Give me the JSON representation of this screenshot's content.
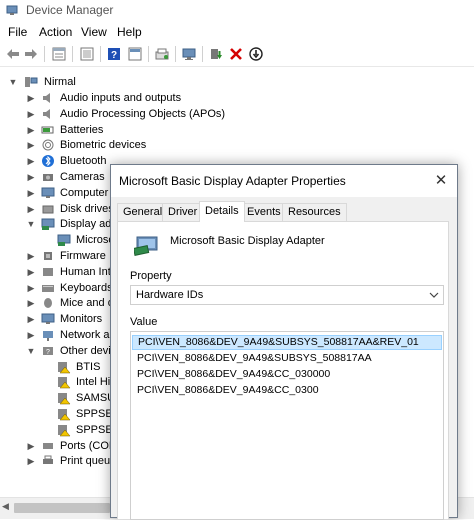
{
  "window": {
    "title": "Device Manager"
  },
  "menu": [
    "File",
    "Action",
    "View",
    "Help"
  ],
  "toolbar": {
    "buttons": [
      "back-icon",
      "forward-icon",
      "properties-icon",
      "show-hide-icon",
      "help-icon",
      "console-icon",
      "scan-hardware-icon",
      "monitor-icon",
      "update-driver-icon",
      "uninstall-icon",
      "disable-icon"
    ]
  },
  "tree": {
    "root": "Nirmal",
    "items": [
      {
        "label": "Audio inputs and outputs",
        "icon": "speaker-icon"
      },
      {
        "label": "Audio Processing Objects (APOs)",
        "icon": "speaker-icon"
      },
      {
        "label": "Batteries",
        "icon": "battery-icon"
      },
      {
        "label": "Biometric devices",
        "icon": "fingerprint-icon"
      },
      {
        "label": "Bluetooth",
        "icon": "bluetooth-icon"
      },
      {
        "label": "Cameras",
        "icon": "camera-icon"
      },
      {
        "label": "Computer",
        "icon": "computer-icon"
      },
      {
        "label": "Disk drives",
        "icon": "disk-icon"
      },
      {
        "label": "Display ada",
        "icon": "display-icon"
      },
      {
        "label": "Microso",
        "icon": "display-icon"
      },
      {
        "label": "Firmware",
        "icon": "firmware-icon"
      },
      {
        "label": "Human Inte",
        "icon": "hid-icon"
      },
      {
        "label": "Keyboards",
        "icon": "keyboard-icon"
      },
      {
        "label": "Mice and ot",
        "icon": "mouse-icon"
      },
      {
        "label": "Monitors",
        "icon": "monitor-icon"
      },
      {
        "label": "Network ad",
        "icon": "network-icon"
      },
      {
        "label": "Other devic",
        "icon": "unknown-device-icon"
      },
      {
        "label": "BTIS",
        "icon": "warning-device-icon"
      },
      {
        "label": "Intel Hi",
        "icon": "warning-device-icon"
      },
      {
        "label": "SAMSU",
        "icon": "warning-device-icon"
      },
      {
        "label": "SPPSER",
        "icon": "warning-device-icon"
      },
      {
        "label": "SPPSER",
        "icon": "warning-device-icon"
      },
      {
        "label": "Ports (COM",
        "icon": "port-icon"
      },
      {
        "label": "Print queue",
        "icon": "printer-icon"
      }
    ]
  },
  "dialog": {
    "title": "Microsoft Basic Display Adapter Properties",
    "close": "✕",
    "tabs": [
      "General",
      "Driver",
      "Details",
      "Events",
      "Resources"
    ],
    "active_tab": "Details",
    "device_name": "Microsoft Basic Display Adapter",
    "property_label": "Property",
    "property_value": "Hardware IDs",
    "value_label": "Value",
    "values": [
      "PCI\\VEN_8086&DEV_9A49&SUBSYS_508817AA&REV_01",
      "PCI\\VEN_8086&DEV_9A49&SUBSYS_508817AA",
      "PCI\\VEN_8086&DEV_9A49&CC_030000",
      "PCI\\VEN_8086&DEV_9A49&CC_0300"
    ],
    "selected_index": 0
  },
  "colors": {
    "selection": "#cce8ff",
    "selection_border": "#99d1ff",
    "uninstall_red": "#d40000",
    "help_blue": "#1e4fb5"
  }
}
